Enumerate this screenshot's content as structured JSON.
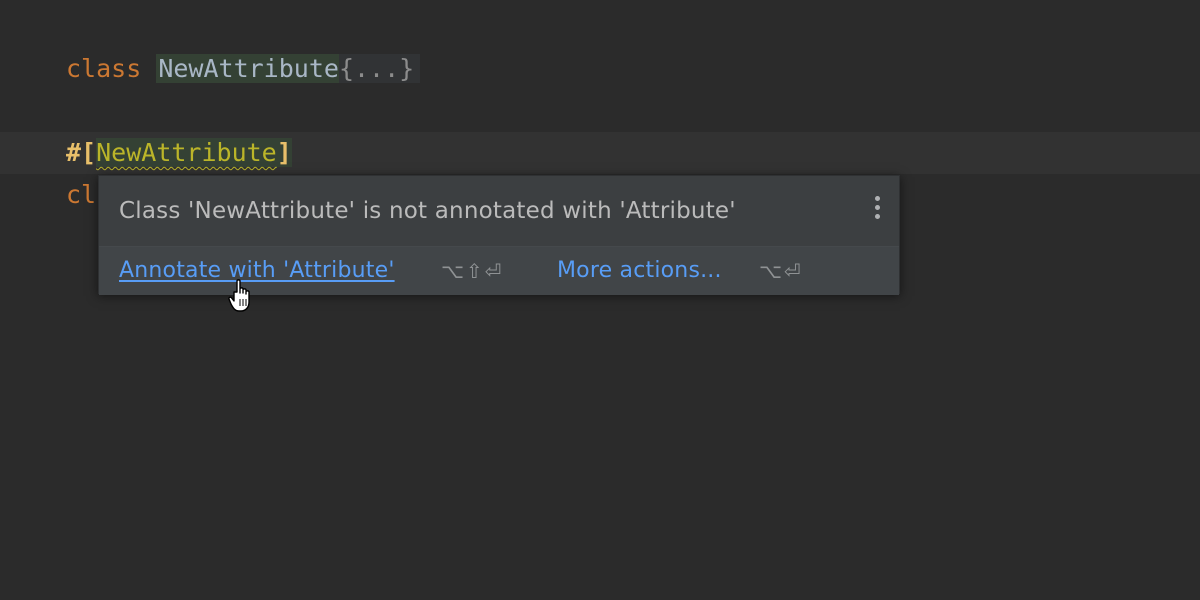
{
  "editor": {
    "line1": {
      "keyword": "class",
      "class_name": "NewAttribute",
      "folded": "{...}"
    },
    "line2": {
      "open": "#[",
      "attribute_name": "NewAttribute",
      "close": "]"
    },
    "line3": {
      "partial": "cl"
    }
  },
  "popup": {
    "message": "Class 'NewAttribute' is not annotated with 'Attribute'",
    "menu_icon": "more-vertical-icon",
    "primary_action": "Annotate with 'Attribute'",
    "primary_shortcut": "⌥⇧⏎",
    "more_actions": "More actions...",
    "more_shortcut": "⌥⏎"
  },
  "colors": {
    "background": "#2b2b2b",
    "keyword": "#cc7832",
    "attribute": "#bbb529",
    "link": "#589df6",
    "popup_bg": "#3c3f41"
  }
}
